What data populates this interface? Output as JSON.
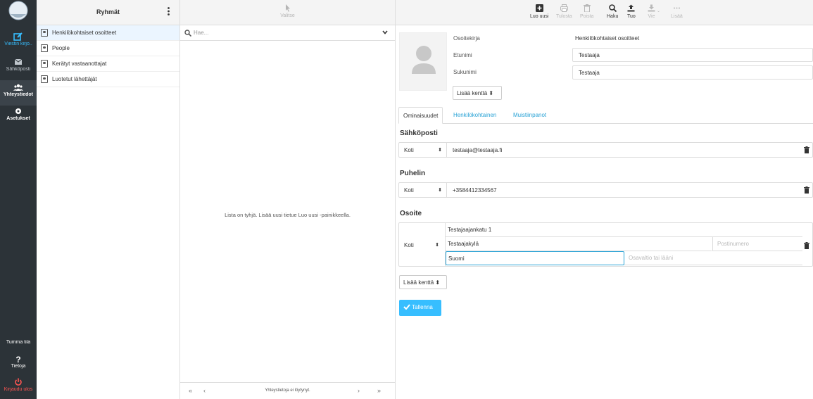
{
  "nav": {
    "items": [
      {
        "label": "Viestin kirjo..",
        "icon": "compose-icon"
      },
      {
        "label": "Sähköposti",
        "icon": "mail-icon"
      },
      {
        "label": "Yhteystiedot",
        "icon": "contacts-icon"
      },
      {
        "label": "Asetukset",
        "icon": "gear-icon"
      }
    ],
    "bottom": [
      {
        "label": "Tumma tila",
        "icon": "moon-icon"
      },
      {
        "label": "Tietoja",
        "icon": "question-icon"
      },
      {
        "label": "Kirjaudu ulos",
        "icon": "power-icon"
      }
    ]
  },
  "groups": {
    "title": "Ryhmät",
    "items": [
      "Henkilökohtaiset osoitteet",
      "People",
      "Kerätyt vastaanottajat",
      "Luotetut lähettäjät"
    ]
  },
  "list": {
    "select_label": "Valitse",
    "search_placeholder": "Hae...",
    "empty_text": "Lista on tyhjä. Lisää uusi tietue Luo uusi -painikkeella.",
    "count_text": "Yhteystietoja ei löytynyt.",
    "pager": {
      "first": "«",
      "prev": "‹",
      "next": "›",
      "last": "»"
    }
  },
  "toolbar": {
    "create": "Luo uusi",
    "print": "Tulosta",
    "delete": "Poista",
    "search": "Haku",
    "import": "Tuo",
    "export": "Vie",
    "more": "Lisää"
  },
  "contact": {
    "addressbook_label": "Osoitekirja",
    "addressbook_value": "Henkilökohtaiset osoitteet",
    "firstname_label": "Etunimi",
    "firstname_value": "Testaaja",
    "surname_label": "Sukunimi",
    "surname_value": "Testaaja",
    "add_field": "Lisää kenttä ⬍",
    "tabs": [
      "Ominaisuudet",
      "Henkilökohtainen",
      "Muistiinpanot"
    ],
    "email_title": "Sähköposti",
    "email_type": "Koti",
    "email_value": "testaaja@testaaja.fi",
    "phone_title": "Puhelin",
    "phone_type": "Koti",
    "phone_value": "+3584412334567",
    "address_title": "Osoite",
    "address_type": "Koti",
    "street": "Testajaajankatu 1",
    "city": "Testaajakylä",
    "postcode_placeholder": "Postinumero",
    "country": "Suomi",
    "region_placeholder": "Osavaltio tai lääni",
    "add_field_bottom": "Lisää kenttä ⬍",
    "save": "Tallenna"
  }
}
